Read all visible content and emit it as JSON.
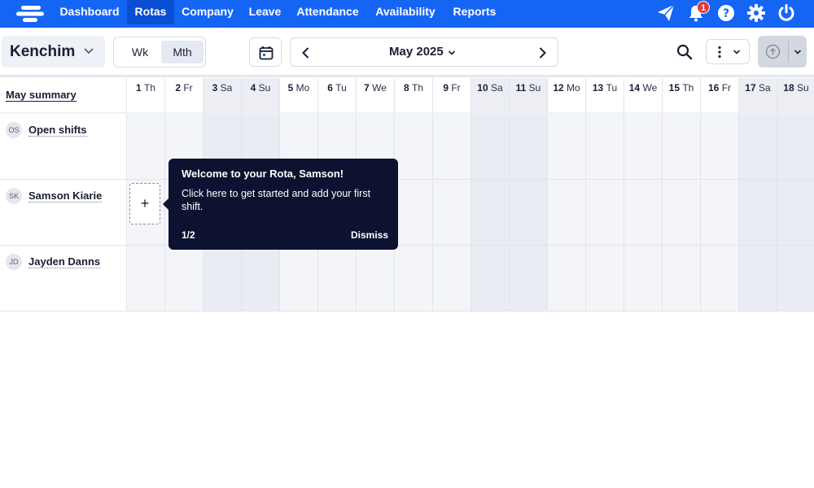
{
  "nav": {
    "items": [
      {
        "label": "Dashboard",
        "name": "nav-dashboard",
        "active": false
      },
      {
        "label": "Rotas",
        "name": "nav-rotas",
        "active": true
      },
      {
        "label": "Company",
        "name": "nav-company",
        "active": false
      },
      {
        "label": "Leave",
        "name": "nav-leave",
        "active": false
      },
      {
        "label": "Attendance",
        "name": "nav-attendance",
        "active": false
      },
      {
        "label": "Availability",
        "name": "nav-availability",
        "active": false
      },
      {
        "label": "Reports",
        "name": "nav-reports",
        "active": false
      }
    ],
    "notification_count": "1",
    "icons": [
      "paper-plane-icon",
      "bell-icon",
      "help-icon",
      "gear-icon",
      "power-icon"
    ]
  },
  "toolbar": {
    "org_name": "Kenchim",
    "view_week": "Wk",
    "view_month": "Mth",
    "current_period": "May 2025"
  },
  "grid": {
    "summary_label": "May summary",
    "days": [
      {
        "num": "1",
        "dname": "Th",
        "weekend": false
      },
      {
        "num": "2",
        "dname": "Fr",
        "weekend": false
      },
      {
        "num": "3",
        "dname": "Sa",
        "weekend": true
      },
      {
        "num": "4",
        "dname": "Su",
        "weekend": true
      },
      {
        "num": "5",
        "dname": "Mo",
        "weekend": false
      },
      {
        "num": "6",
        "dname": "Tu",
        "weekend": false
      },
      {
        "num": "7",
        "dname": "We",
        "weekend": false
      },
      {
        "num": "8",
        "dname": "Th",
        "weekend": false
      },
      {
        "num": "9",
        "dname": "Fr",
        "weekend": false
      },
      {
        "num": "10",
        "dname": "Sa",
        "weekend": true
      },
      {
        "num": "11",
        "dname": "Su",
        "weekend": true
      },
      {
        "num": "12",
        "dname": "Mo",
        "weekend": false
      },
      {
        "num": "13",
        "dname": "Tu",
        "weekend": false
      },
      {
        "num": "14",
        "dname": "We",
        "weekend": false
      },
      {
        "num": "15",
        "dname": "Th",
        "weekend": false
      },
      {
        "num": "16",
        "dname": "Fr",
        "weekend": false
      },
      {
        "num": "17",
        "dname": "Sa",
        "weekend": true
      },
      {
        "num": "18",
        "dname": "Su",
        "weekend": true
      }
    ],
    "rows": [
      {
        "initials": "OS",
        "name": "Open shifts"
      },
      {
        "initials": "SK",
        "name": "Samson Kiarie"
      },
      {
        "initials": "JD",
        "name": "Jayden Danns"
      }
    ],
    "add_shift_symbol": "+"
  },
  "tooltip": {
    "title": "Welcome to your Rota, Samson!",
    "body": "Click here to get started and add your first shift.",
    "step": "1/2",
    "dismiss": "Dismiss"
  },
  "colors": {
    "nav_bg": "#1565f5",
    "nav_active": "#0a4ed1",
    "tooltip_bg": "#0d1230",
    "badge": "#e53935"
  }
}
